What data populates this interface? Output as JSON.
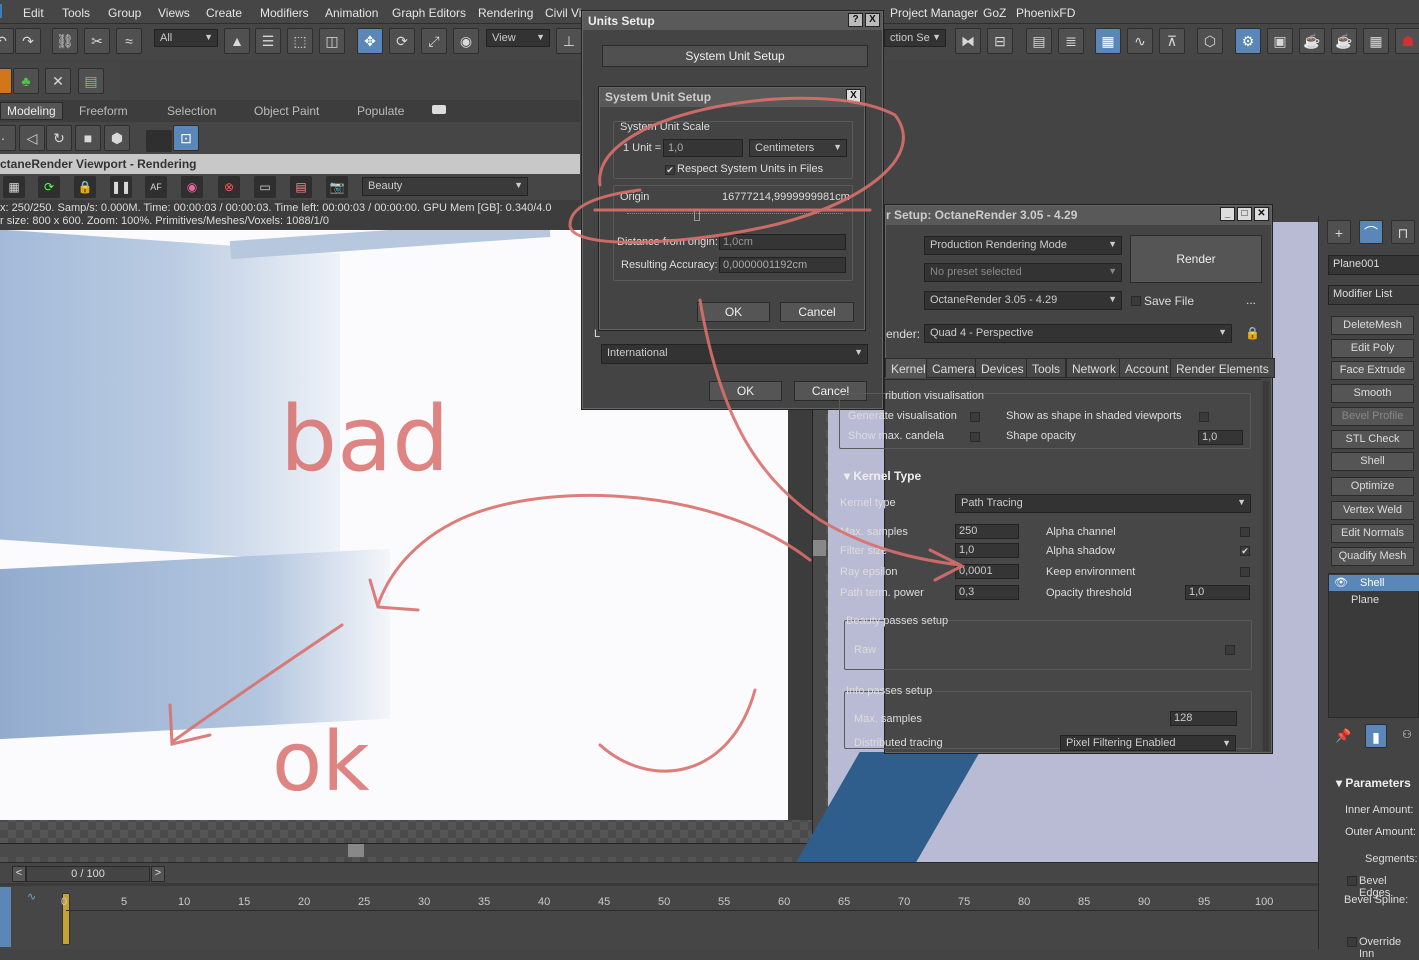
{
  "menu": [
    "Edit",
    "Tools",
    "Group",
    "Views",
    "Create",
    "Modifiers",
    "Animation",
    "Graph Editors",
    "Rendering",
    "Civil Vie",
    "Project Manager",
    "GoZ",
    "PhoenixFD"
  ],
  "toolbar": {
    "selection_filter": "All",
    "ref_coord": "View",
    "named_sel": "ction Se"
  },
  "ribbon_tabs": [
    "Modeling",
    "Freeform",
    "Selection",
    "Object Paint",
    "Populate"
  ],
  "viewport": {
    "title": "ctaneRender Viewport - Rendering",
    "pass": "Beauty",
    "status1": "x: 250/250.   Samp/s: 0.000M.   Time: 00:00:03 / 00:00:03.   Time left: 00:00:03 / 00:00:00.   GPU Mem [GB]: 0.340/4.0",
    "status2": "r size: 800 x 600.   Zoom: 100%.   Primitives/Meshes/Voxels: 1088/1/0"
  },
  "units_setup": {
    "title": "Units Setup",
    "system_unit_btn": "System Unit Setup",
    "lighting_label": "L",
    "lighting_value": "International",
    "ok": "OK",
    "cancel": "Cancel",
    "help": "?",
    "close": "X"
  },
  "system_unit": {
    "title": "System Unit Setup",
    "close": "X",
    "scale_group": "System Unit Scale",
    "unit_label": "1 Unit =",
    "unit_value": "1,0",
    "unit_type": "Centimeters",
    "respect": "Respect System Units in Files",
    "origin_label": "Origin",
    "origin_value": "16777214,9999999981cm",
    "dist_label": "Distance from origin:",
    "dist_value": "1,0cm",
    "acc_label": "Resulting Accuracy:",
    "acc_value": "0,0000001192cm",
    "ok": "OK",
    "cancel": "Cancel"
  },
  "render_setup": {
    "title": "r Setup: OctaneRender 3.05 - 4.29",
    "target": "Production Rendering Mode",
    "preset": "No preset selected",
    "renderer": "OctaneRender 3.05 - 4.29",
    "render_btn": "Render",
    "save_file": "Save File",
    "more": "...",
    "view_label": "ender:",
    "view_value": "Quad 4 - Perspective",
    "tabs": [
      "Kernel",
      "Camera",
      "Devices",
      "Tools",
      "Network",
      "Account",
      "Render Elements"
    ],
    "dist_vis_title": "ribution visualisation",
    "gen_vis": "Generate visualisation",
    "show_shape": "Show as shape in shaded viewports",
    "show_candela": "Show max. candela",
    "shape_opacity": "Shape opacity",
    "shape_opacity_val": "1,0",
    "kernel_title": "Kernel Type",
    "kernel_type_label": "Kernel type",
    "kernel_type": "Path Tracing",
    "max_samples": "Max. samples",
    "max_samples_val": "250",
    "filter_size": "Filter size",
    "filter_size_val": "1,0",
    "ray_eps": "Ray epsilon",
    "ray_eps_val": "0,0001",
    "path_term": "Path term. power",
    "path_term_val": "0,3",
    "alpha_channel": "Alpha channel",
    "alpha_shadow": "Alpha shadow",
    "keep_env": "Keep environment",
    "opacity_thr": "Opacity threshold",
    "opacity_thr_val": "1,0",
    "beauty_group": "Beauty passes setup",
    "raw": "Raw",
    "info_group": "Info passes setup",
    "info_max": "Max. samples",
    "info_max_val": "128",
    "dist_tracing": "Distributed tracing",
    "dist_tracing_val": "Pixel Filtering Enabled",
    "checkmark": "✔"
  },
  "command_panel": {
    "object_name": "Plane001",
    "modifier_list": "Modifier List",
    "buttons": [
      "DeleteMesh",
      "Edit Poly",
      "Face Extrude",
      "Smooth",
      "Bevel Profile",
      "STL Check",
      "Shell",
      "Optimize",
      "Vertex Weld",
      "Edit Normals",
      "Quadify Mesh"
    ],
    "stack": [
      "Shell",
      "Plane"
    ],
    "params_title": "Parameters",
    "inner": "Inner Amount:",
    "outer": "Outer Amount:",
    "segments": "Segments:",
    "bevel_edges": "Bevel Edges",
    "bevel_spline": "Bevel Spline:",
    "override": "Override Inn"
  },
  "timeline": {
    "frame": "0 / 100",
    "ticks": [
      "0",
      "5",
      "10",
      "15",
      "20",
      "25",
      "30",
      "35",
      "40",
      "45",
      "50",
      "55",
      "60",
      "65",
      "70",
      "75",
      "80",
      "85",
      "90",
      "95",
      "100"
    ]
  },
  "annotations": [
    "bad",
    "ok",
    "😊"
  ],
  "colors": {
    "bg": "#444444",
    "accent": "#5b87b8",
    "ink": "#d9706d",
    "viewport_bg": "#b9bad3"
  }
}
